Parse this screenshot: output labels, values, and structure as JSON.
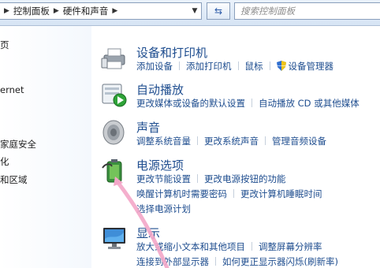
{
  "address_bar": {
    "breadcrumbs": [
      "控制面板",
      "硬件和声音"
    ],
    "search_placeholder": "搜索控制面板"
  },
  "sidebar": {
    "items": [
      "页",
      "ernet",
      "家庭安全",
      "化",
      "和区域"
    ]
  },
  "sections": [
    {
      "title": "设备和打印机",
      "links": [
        "添加设备",
        "添加打印机",
        "鼠标",
        "设备管理器"
      ]
    },
    {
      "title": "自动播放",
      "links": [
        "更改媒体或设备的默认设置",
        "自动播放 CD 或其他媒体"
      ]
    },
    {
      "title": "声音",
      "links": [
        "调整系统音量",
        "更改系统声音",
        "管理音频设备"
      ]
    },
    {
      "title": "电源选项",
      "links": [
        "更改节能设置",
        "更改电源按钮的功能",
        "唤醒计算机时需要密码",
        "更改计算机睡眠时间",
        "选择电源计划"
      ]
    },
    {
      "title": "显示",
      "links": [
        "放大或缩小文本和其他项目",
        "调整屏幕分辨率",
        "连接到外部显示器",
        "如何更正显示器闪烁(刷新率)"
      ]
    }
  ],
  "colors": {
    "link": "#1e4d8f",
    "annotation_arrow": "#f3a6c8"
  }
}
